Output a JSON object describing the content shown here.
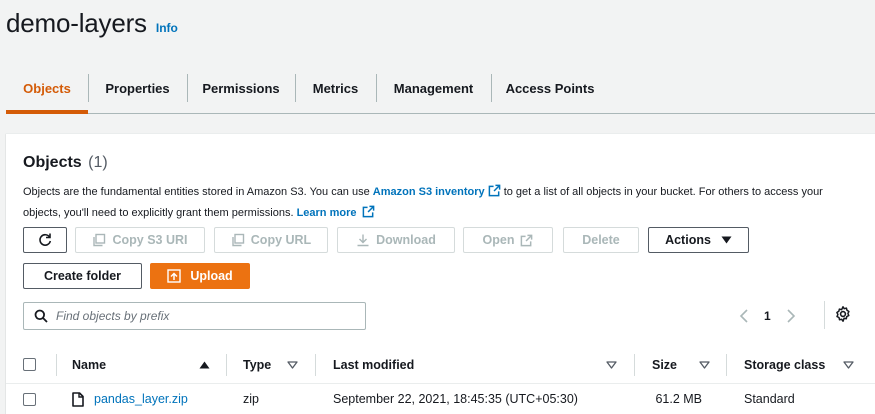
{
  "header": {
    "title": "demo-layers",
    "info_link": "Info"
  },
  "tabs": [
    {
      "label": "Objects",
      "active": true
    },
    {
      "label": "Properties",
      "active": false
    },
    {
      "label": "Permissions",
      "active": false
    },
    {
      "label": "Metrics",
      "active": false
    },
    {
      "label": "Management",
      "active": false
    },
    {
      "label": "Access Points",
      "active": false
    }
  ],
  "objects_panel": {
    "heading": "Objects",
    "count": "(1)",
    "desc_part1": "Objects are the fundamental entities stored in Amazon S3. You can use ",
    "inventory_link": "Amazon S3 inventory",
    "desc_part2": " to get a list of all objects in your bucket. For others to access your objects, you'll need to explicitly grant them permissions. ",
    "learn_more_link": "Learn more"
  },
  "toolbar": {
    "copy_s3_uri": "Copy S3 URI",
    "copy_url": "Copy URL",
    "download": "Download",
    "open": "Open",
    "delete": "Delete",
    "actions": "Actions",
    "create_folder": "Create folder",
    "upload": "Upload"
  },
  "search": {
    "placeholder": "Find objects by prefix",
    "value": ""
  },
  "pagination": {
    "current_page": "1"
  },
  "table": {
    "columns": {
      "name": "Name",
      "type": "Type",
      "last_modified": "Last modified",
      "size": "Size",
      "storage_class": "Storage class"
    },
    "rows": [
      {
        "name": "pandas_layer.zip",
        "type": "zip",
        "last_modified": "September 22, 2021, 18:45:35 (UTC+05:30)",
        "size": "61.2 MB",
        "storage_class": "Standard"
      }
    ]
  },
  "colors": {
    "accent": "#ec7211",
    "active_tab": "#d45b07",
    "link": "#0073bb",
    "text": "#16191f",
    "disabled": "#aab7b8"
  },
  "icons": [
    "refresh-icon",
    "copy-icon",
    "download-icon",
    "external-link-icon",
    "caret-down-icon",
    "upload-icon",
    "search-icon",
    "chevron-left-icon",
    "chevron-right-icon",
    "gear-icon",
    "sort-ascending-icon",
    "filter-caret-icon",
    "file-icon"
  ]
}
